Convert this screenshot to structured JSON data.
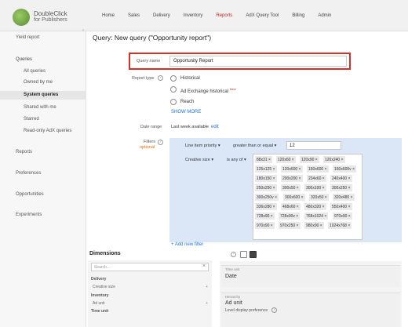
{
  "header": {
    "logo_line1": "DoubleClick",
    "logo_line2": "for Publishers",
    "nav": [
      "Home",
      "Sales",
      "Delivery",
      "Inventory",
      "Reports",
      "AdX Query Tool",
      "Billing",
      "Admin"
    ],
    "active_nav": "Reports"
  },
  "sidebar": {
    "yield_report": "Yield report",
    "queries": "Queries",
    "query_items": [
      "All queries",
      "Owned by me",
      "System queries",
      "Shared with me",
      "Starred",
      "Read-only AdX queries"
    ],
    "selected": "System queries",
    "sections": [
      "Reports",
      "Preferences",
      "Opportunities",
      "Experiments"
    ]
  },
  "query": {
    "title": "Query: New query (\"Opportunity report\")",
    "name_label": "Query name",
    "name_value": "Opportunity Report",
    "report_type_label": "Report type",
    "report_types": [
      "Historical",
      "Ad Exchange historical",
      "Reach"
    ],
    "new_badge": "New",
    "show_more": "SHOW MORE",
    "date_range_label": "Date range",
    "date_range_value": "Last week available",
    "edit_link": "edit",
    "filters_label": "Filters",
    "filters_optional": "optional"
  },
  "filters": {
    "row1": {
      "field": "Line item priority",
      "op": "greater than or equal",
      "value": "12"
    },
    "row2": {
      "field": "Creative size",
      "op": "is any of"
    },
    "sizes": [
      "88x31",
      "120x60",
      "120x90",
      "120x240",
      "125x125",
      "120x600",
      "160x600",
      "160x600v",
      "180x150",
      "200x200",
      "234x60",
      "240x400",
      "250x250",
      "300x50",
      "300x100",
      "300x250",
      "300x250v",
      "300x600",
      "320x50",
      "320x480",
      "336x280",
      "468x60",
      "480x320",
      "550x400",
      "728x90",
      "728x90v",
      "768x1024",
      "970x90",
      "970x90",
      "970x250",
      "980x90",
      "1024x768"
    ],
    "add_new": "+ Add new filter"
  },
  "dimensions": {
    "title": "Dimensions",
    "search_placeholder": "Search...",
    "groups": [
      {
        "name": "Delivery",
        "items": [
          "Creative size"
        ]
      },
      {
        "name": "Inventory",
        "items": [
          "Ad unit"
        ]
      },
      {
        "name": "Time unit",
        "items": []
      }
    ],
    "selected": [
      {
        "label": "Time unit",
        "value": "Date"
      },
      {
        "label": "Hierarchy",
        "value": "Ad unit",
        "extra": "Level display preference"
      }
    ]
  }
}
